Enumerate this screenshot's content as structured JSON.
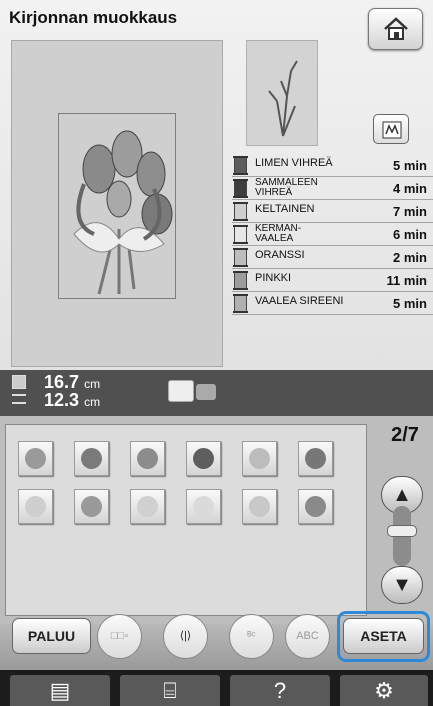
{
  "title": "Kirjonnan muokkaus",
  "threads": [
    {
      "name": "LIMEN VIHREÄ",
      "time": "5 min",
      "color": "#5c5c5c"
    },
    {
      "name": "SAMMALEEN\nVIHREÄ",
      "time": "4 min",
      "color": "#3d3d3d"
    },
    {
      "name": "KELTAINEN",
      "time": "7 min",
      "color": "#cfcfcf"
    },
    {
      "name": "KERMAN-\nVAALEA",
      "time": "6 min",
      "color": "#e6e6e6"
    },
    {
      "name": "ORANSSI",
      "time": "2 min",
      "color": "#bdbdbd"
    },
    {
      "name": "PINKKI",
      "time": "11 min",
      "color": "#9c9c9c"
    },
    {
      "name": "VAALEA SIREENI",
      "time": "5 min",
      "color": "#b0b0b0"
    }
  ],
  "size": {
    "height": "16.7",
    "width": "12.3",
    "unit": "cm"
  },
  "pager": {
    "current": "2",
    "total": "7"
  },
  "buttons": {
    "back": "PALUU",
    "set": "ASETA",
    "abc_label": "ABC"
  },
  "pattern_icons": [
    "snowflake-pattern",
    "lighthouse-pattern",
    "windmill-pattern",
    "fish-pattern",
    "flower-sprig-pattern",
    "vase-pattern",
    "wreath-pattern",
    "flower-cluster-pattern",
    "tulip-pattern",
    "star-pattern",
    "rose-pattern",
    "bouquet-pattern"
  ],
  "bottom_tabs": [
    "page-icon",
    "sewing-icon",
    "?",
    "settings-icon"
  ]
}
